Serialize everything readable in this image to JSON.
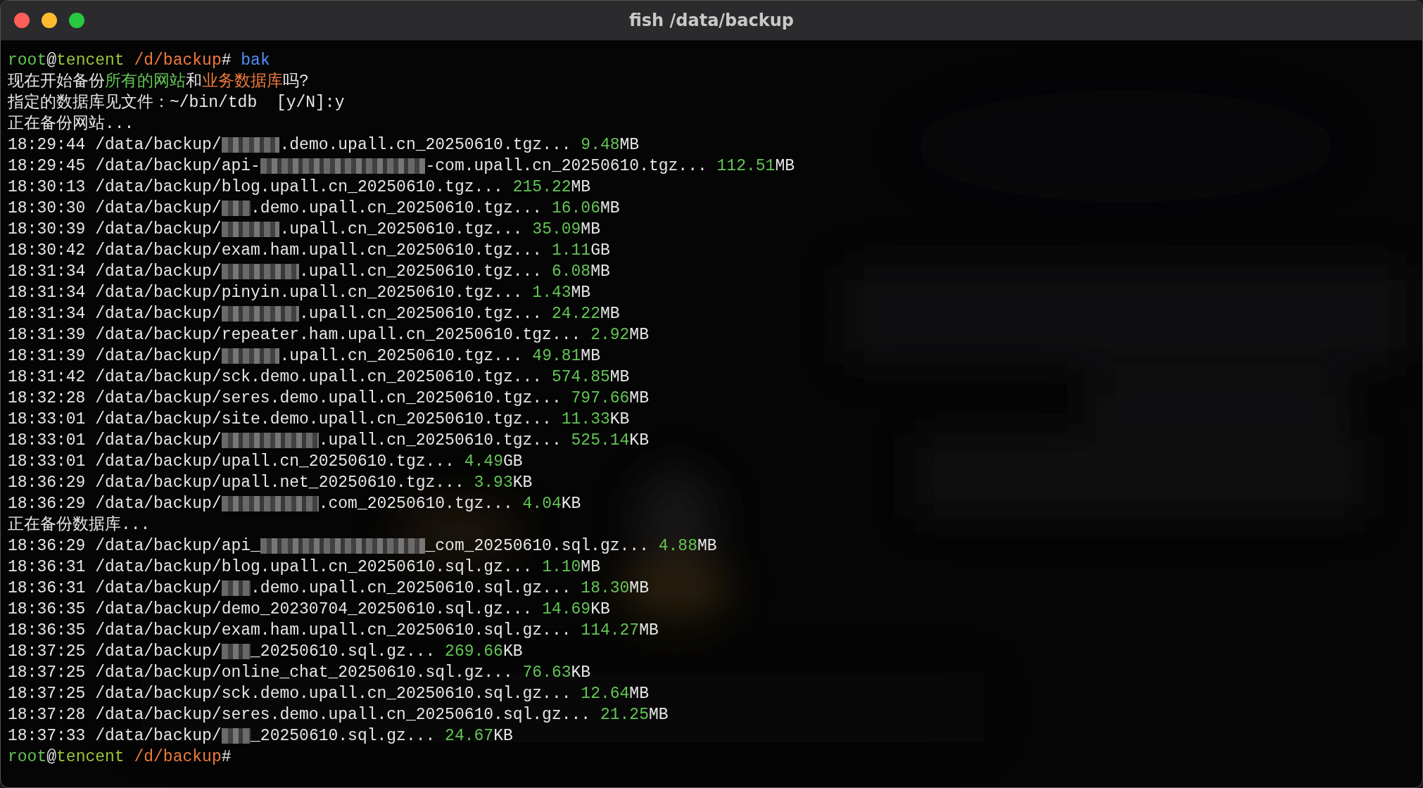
{
  "window": {
    "title": "fish /data/backup"
  },
  "lines": [
    {
      "segments": [
        {
          "kind": "green",
          "text": "root"
        },
        {
          "kind": "plain",
          "text": "@"
        },
        {
          "kind": "lime",
          "text": "tencent"
        },
        {
          "kind": "orange",
          "text": " /d/backup"
        },
        {
          "kind": "plain",
          "text": "# "
        },
        {
          "kind": "blue",
          "text": "bak"
        }
      ]
    },
    {
      "segments": [
        {
          "kind": "plain",
          "text": "现在开始备份"
        },
        {
          "kind": "green",
          "text": "所有的网站"
        },
        {
          "kind": "plain",
          "text": "和"
        },
        {
          "kind": "orange",
          "text": "业务数据库"
        },
        {
          "kind": "plain",
          "text": "吗?"
        }
      ]
    },
    {
      "segments": [
        {
          "kind": "plain",
          "text": "指定的数据库见文件：~/bin/tdb  [y/N]:y"
        }
      ]
    },
    {
      "segments": [
        {
          "kind": "plain",
          "text": "正在备份网站..."
        }
      ]
    },
    {
      "segments": [
        {
          "kind": "plain",
          "text": "18:29:44 /data/backup/"
        },
        {
          "kind": "redacted_medium"
        },
        {
          "kind": "plain",
          "text": ".demo.upall.cn_20250610.tgz... "
        },
        {
          "kind": "green",
          "text": "9.48"
        },
        {
          "kind": "plain",
          "text": "MB"
        }
      ]
    },
    {
      "segments": [
        {
          "kind": "plain",
          "text": "18:29:45 /data/backup/api-"
        },
        {
          "kind": "redacted_huge"
        },
        {
          "kind": "plain",
          "text": "-com.upall.cn_20250610.tgz... "
        },
        {
          "kind": "green",
          "text": "112.51"
        },
        {
          "kind": "plain",
          "text": "MB"
        }
      ]
    },
    {
      "segments": [
        {
          "kind": "plain",
          "text": "18:30:13 /data/backup/blog.upall.cn_20250610.tgz... "
        },
        {
          "kind": "green",
          "text": "215.22"
        },
        {
          "kind": "plain",
          "text": "MB"
        }
      ]
    },
    {
      "segments": [
        {
          "kind": "plain",
          "text": "18:30:30 /data/backup/"
        },
        {
          "kind": "redacted_short"
        },
        {
          "kind": "plain",
          "text": ".demo.upall.cn_20250610.tgz... "
        },
        {
          "kind": "green",
          "text": "16.06"
        },
        {
          "kind": "plain",
          "text": "MB"
        }
      ]
    },
    {
      "segments": [
        {
          "kind": "plain",
          "text": "18:30:39 /data/backup/"
        },
        {
          "kind": "redacted_medium"
        },
        {
          "kind": "plain",
          "text": ".upall.cn_20250610.tgz... "
        },
        {
          "kind": "green",
          "text": "35.09"
        },
        {
          "kind": "plain",
          "text": "MB"
        }
      ]
    },
    {
      "segments": [
        {
          "kind": "plain",
          "text": "18:30:42 /data/backup/exam.ham.upall.cn_20250610.tgz... "
        },
        {
          "kind": "green",
          "text": "1.11"
        },
        {
          "kind": "plain",
          "text": "GB"
        }
      ]
    },
    {
      "segments": [
        {
          "kind": "plain",
          "text": "18:31:34 /data/backup/"
        },
        {
          "kind": "redacted_long"
        },
        {
          "kind": "plain",
          "text": ".upall.cn_20250610.tgz... "
        },
        {
          "kind": "green",
          "text": "6.08"
        },
        {
          "kind": "plain",
          "text": "MB"
        }
      ]
    },
    {
      "segments": [
        {
          "kind": "plain",
          "text": "18:31:34 /data/backup/pinyin.upall.cn_20250610.tgz... "
        },
        {
          "kind": "green",
          "text": "1.43"
        },
        {
          "kind": "plain",
          "text": "MB"
        }
      ]
    },
    {
      "segments": [
        {
          "kind": "plain",
          "text": "18:31:34 /data/backup/"
        },
        {
          "kind": "redacted_long"
        },
        {
          "kind": "plain",
          "text": ".upall.cn_20250610.tgz... "
        },
        {
          "kind": "green",
          "text": "24.22"
        },
        {
          "kind": "plain",
          "text": "MB"
        }
      ]
    },
    {
      "segments": [
        {
          "kind": "plain",
          "text": "18:31:39 /data/backup/repeater.ham.upall.cn_20250610.tgz... "
        },
        {
          "kind": "green",
          "text": "2.92"
        },
        {
          "kind": "plain",
          "text": "MB"
        }
      ]
    },
    {
      "segments": [
        {
          "kind": "plain",
          "text": "18:31:39 /data/backup/"
        },
        {
          "kind": "redacted_medium"
        },
        {
          "kind": "plain",
          "text": ".upall.cn_20250610.tgz... "
        },
        {
          "kind": "green",
          "text": "49.81"
        },
        {
          "kind": "plain",
          "text": "MB"
        }
      ]
    },
    {
      "segments": [
        {
          "kind": "plain",
          "text": "18:31:42 /data/backup/sck.demo.upall.cn_20250610.tgz... "
        },
        {
          "kind": "green",
          "text": "574.85"
        },
        {
          "kind": "plain",
          "text": "MB"
        }
      ]
    },
    {
      "segments": [
        {
          "kind": "plain",
          "text": "18:32:28 /data/backup/seres.demo.upall.cn_20250610.tgz... "
        },
        {
          "kind": "green",
          "text": "797.66"
        },
        {
          "kind": "plain",
          "text": "MB"
        }
      ]
    },
    {
      "segments": [
        {
          "kind": "plain",
          "text": "18:33:01 /data/backup/site.demo.upall.cn_20250610.tgz... "
        },
        {
          "kind": "green",
          "text": "11.33"
        },
        {
          "kind": "plain",
          "text": "KB"
        }
      ]
    },
    {
      "segments": [
        {
          "kind": "plain",
          "text": "18:33:01 /data/backup/"
        },
        {
          "kind": "redacted_wide"
        },
        {
          "kind": "plain",
          "text": ".upall.cn_20250610.tgz... "
        },
        {
          "kind": "green",
          "text": "525.14"
        },
        {
          "kind": "plain",
          "text": "KB"
        }
      ]
    },
    {
      "segments": [
        {
          "kind": "plain",
          "text": "18:33:01 /data/backup/upall.cn_20250610.tgz... "
        },
        {
          "kind": "green",
          "text": "4.49"
        },
        {
          "kind": "plain",
          "text": "GB"
        }
      ]
    },
    {
      "segments": [
        {
          "kind": "plain",
          "text": "18:36:29 /data/backup/upall.net_20250610.tgz... "
        },
        {
          "kind": "green",
          "text": "3.93"
        },
        {
          "kind": "plain",
          "text": "KB"
        }
      ]
    },
    {
      "segments": [
        {
          "kind": "plain",
          "text": "18:36:29 /data/backup/"
        },
        {
          "kind": "redacted_wide"
        },
        {
          "kind": "plain",
          "text": ".com_20250610.tgz... "
        },
        {
          "kind": "green",
          "text": "4.04"
        },
        {
          "kind": "plain",
          "text": "KB"
        }
      ]
    },
    {
      "segments": [
        {
          "kind": "plain",
          "text": "正在备份数据库..."
        }
      ]
    },
    {
      "segments": [
        {
          "kind": "plain",
          "text": "18:36:29 /data/backup/api_"
        },
        {
          "kind": "redacted_huge"
        },
        {
          "kind": "plain",
          "text": "_com_20250610.sql.gz... "
        },
        {
          "kind": "green",
          "text": "4.88"
        },
        {
          "kind": "plain",
          "text": "MB"
        }
      ]
    },
    {
      "segments": [
        {
          "kind": "plain",
          "text": "18:36:31 /data/backup/blog.upall.cn_20250610.sql.gz... "
        },
        {
          "kind": "green",
          "text": "1.10"
        },
        {
          "kind": "plain",
          "text": "MB"
        }
      ]
    },
    {
      "segments": [
        {
          "kind": "plain",
          "text": "18:36:31 /data/backup/"
        },
        {
          "kind": "redacted_short"
        },
        {
          "kind": "plain",
          "text": ".demo.upall.cn_20250610.sql.gz... "
        },
        {
          "kind": "green",
          "text": "18.30"
        },
        {
          "kind": "plain",
          "text": "MB"
        }
      ]
    },
    {
      "segments": [
        {
          "kind": "plain",
          "text": "18:36:35 /data/backup/demo_20230704_20250610.sql.gz... "
        },
        {
          "kind": "green",
          "text": "14.69"
        },
        {
          "kind": "plain",
          "text": "KB"
        }
      ]
    },
    {
      "segments": [
        {
          "kind": "plain",
          "text": "18:36:35 /data/backup/exam.ham.upall.cn_20250610.sql.gz... "
        },
        {
          "kind": "green",
          "text": "114.27"
        },
        {
          "kind": "plain",
          "text": "MB"
        }
      ]
    },
    {
      "segments": [
        {
          "kind": "plain",
          "text": "18:37:25 /data/backup/"
        },
        {
          "kind": "redacted_short"
        },
        {
          "kind": "plain",
          "text": "_20250610.sql.gz... "
        },
        {
          "kind": "green",
          "text": "269.66"
        },
        {
          "kind": "plain",
          "text": "KB"
        }
      ]
    },
    {
      "segments": [
        {
          "kind": "plain",
          "text": "18:37:25 /data/backup/online_chat_20250610.sql.gz... "
        },
        {
          "kind": "green",
          "text": "76.63"
        },
        {
          "kind": "plain",
          "text": "KB"
        }
      ]
    },
    {
      "segments": [
        {
          "kind": "plain",
          "text": "18:37:25 /data/backup/sck.demo.upall.cn_20250610.sql.gz... "
        },
        {
          "kind": "green",
          "text": "12.64"
        },
        {
          "kind": "plain",
          "text": "MB"
        }
      ]
    },
    {
      "segments": [
        {
          "kind": "plain",
          "text": "18:37:28 /data/backup/seres.demo.upall.cn_20250610.sql.gz... "
        },
        {
          "kind": "green",
          "text": "21.25"
        },
        {
          "kind": "plain",
          "text": "MB"
        }
      ]
    },
    {
      "segments": [
        {
          "kind": "plain",
          "text": "18:37:33 /data/backup/"
        },
        {
          "kind": "redacted_short"
        },
        {
          "kind": "plain",
          "text": "_20250610.sql.gz... "
        },
        {
          "kind": "green",
          "text": "24.67"
        },
        {
          "kind": "plain",
          "text": "KB"
        }
      ]
    },
    {
      "segments": [
        {
          "kind": "green",
          "text": "root"
        },
        {
          "kind": "plain",
          "text": "@"
        },
        {
          "kind": "lime",
          "text": "tencent"
        },
        {
          "kind": "orange",
          "text": " /d/backup"
        },
        {
          "kind": "plain",
          "text": "#"
        }
      ]
    }
  ]
}
